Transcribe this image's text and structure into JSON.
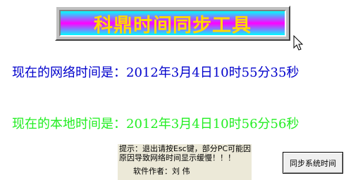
{
  "app": {
    "title": "科鼎时间同步工具"
  },
  "network_time": {
    "label": "现在的网络时间是：",
    "value": "2012年3月4日10时55分35秒"
  },
  "local_time": {
    "label": "现在的本地时间是：",
    "value": "2012年3月4日10时56分56秒"
  },
  "hint": {
    "line1": "提示：退出请按Esc键，部分PC可能因网络",
    "line2": "原因导致网络时间显示缓慢！！！",
    "author": "软件作者：刘 伟"
  },
  "sync_button": {
    "label": "同步系统时间"
  },
  "colors": {
    "network_text": "#0000cc",
    "local_text": "#22ee22",
    "title_text": "#ffd700"
  },
  "icons": {
    "cursor": "mouse-pointer-icon"
  }
}
